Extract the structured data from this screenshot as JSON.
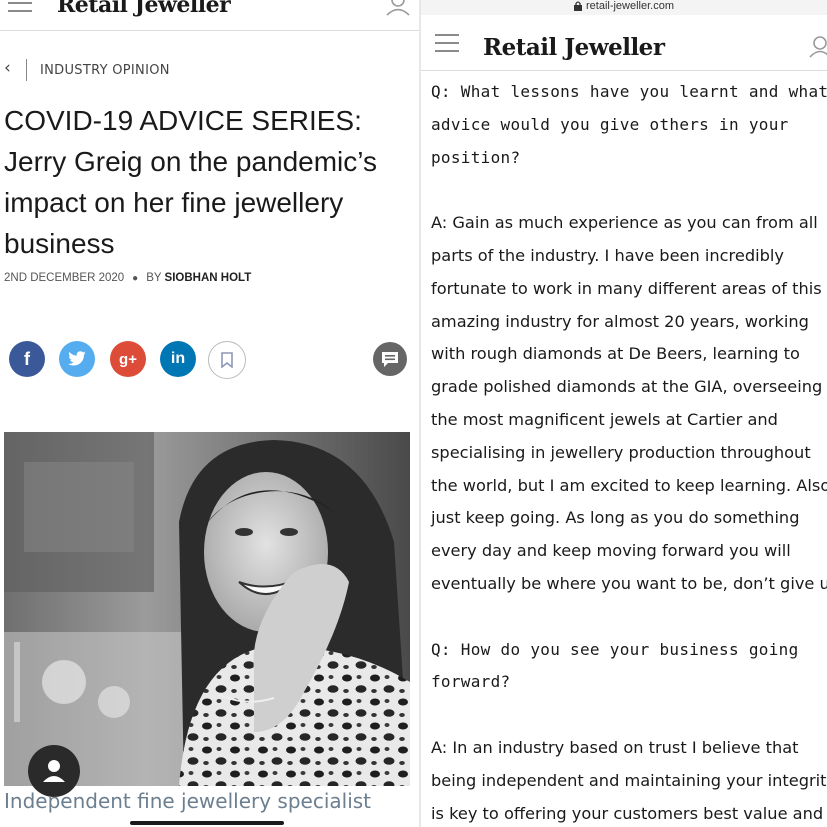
{
  "left": {
    "header": {
      "menu_icon": "hamburger-menu-icon",
      "logo": "Retail Jeweller",
      "user_icon": "user-icon"
    },
    "back_icon": "chevron-left-icon",
    "category": "INDUSTRY OPINION",
    "headline": [
      "COVID-19 ADVICE SERIES:",
      "Jerry Greig on the pandemic’s",
      "impact on her fine jewellery",
      "business"
    ],
    "date": "2ND DECEMBER 2020",
    "by_label": "BY",
    "author": "SIOBHAN HOLT",
    "share": {
      "facebook": "f",
      "twitter_icon": "twitter-bird-icon",
      "googleplus": "g+",
      "linkedin": "in",
      "bookmark_icon": "bookmark-icon",
      "comment_icon": "comment-bubble-icon",
      "colors": {
        "facebook": "#3b5998",
        "twitter": "#55acee",
        "googleplus": "#dd4b39",
        "linkedin": "#0077b5"
      }
    },
    "photo_icon": "portrait-photo",
    "caption": "Independent fine jewellery specialist",
    "profile_icon": "profile-icon"
  },
  "right": {
    "url": "retail-jeweller.com",
    "header": {
      "menu_icon": "hamburger-menu-icon",
      "logo": "Retail Jeweller",
      "user_icon": "user-icon"
    },
    "q1": [
      "Q: What lessons have you learnt and what",
      "advice would you give others in your",
      "position?"
    ],
    "a1": [
      "A: Gain as much experience as you can from all",
      "parts of the industry.  I have been incredibly",
      "fortunate to work in many different areas of this",
      "amazing industry for almost 20 years, working",
      "with rough diamonds at De Beers, learning to",
      "grade polished diamonds at the GIA, overseeing",
      "the most magnificent jewels at Cartier and",
      "specialising in jewellery production throughout",
      "the world, but I am excited to keep learning. Also,",
      "just keep going. As long as you do something",
      "every day and keep moving forward you will",
      "eventually be where you want to be, don’t give up"
    ],
    "q2": [
      "Q: How do you see your business going",
      "forward?"
    ],
    "a2": [
      "A: In an industry based on trust I believe that",
      "being independent and maintaining your integrity",
      "is key to offering your customers best value and"
    ]
  }
}
